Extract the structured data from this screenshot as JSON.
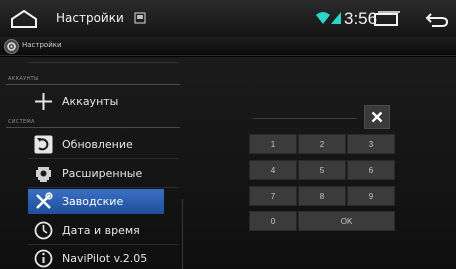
{
  "status_bar": {
    "title": "Настройки",
    "time": "3:56",
    "icons": [
      "home-icon",
      "notification-icon",
      "wifi-icon",
      "signal-icon",
      "recent-apps-icon",
      "back-icon"
    ],
    "accent_color": "#2ad6c8"
  },
  "app_bar": {
    "title": "Настройки",
    "icon": "settings-app-icon"
  },
  "settings": {
    "sections": {
      "accounts": "АККАУНТЫ",
      "system": "СИСТЕМА"
    },
    "items": [
      {
        "label": "Аккаунты",
        "icon": "plus-icon"
      },
      {
        "label": "Обновление",
        "icon": "update-icon"
      },
      {
        "label": "Расширенные",
        "icon": "gear-icon"
      },
      {
        "label": "Заводские",
        "icon": "tools-icon",
        "selected": true
      },
      {
        "label": "Дата и время",
        "icon": "clock-icon"
      },
      {
        "label": "NaviPilot v.2.05",
        "icon": "info-icon"
      }
    ],
    "highlight_color": "#2b5fb3"
  },
  "keypad": {
    "clear": "clear-icon",
    "keys": [
      "1",
      "2",
      "3",
      "4",
      "5",
      "6",
      "7",
      "8",
      "9",
      "0",
      "OK"
    ]
  }
}
